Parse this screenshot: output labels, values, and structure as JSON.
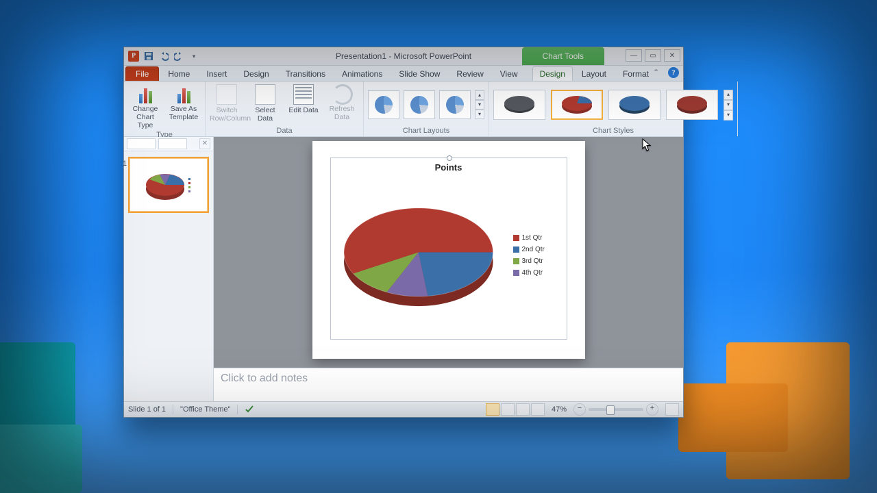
{
  "window": {
    "title": "Presentation1 - Microsoft PowerPoint",
    "context_tab": "Chart Tools"
  },
  "qat": {
    "save": "save-icon",
    "undo": "undo-icon",
    "redo": "redo-icon"
  },
  "tabs": {
    "file": "File",
    "home": "Home",
    "insert": "Insert",
    "design_main": "Design",
    "transitions": "Transitions",
    "animations": "Animations",
    "slideshow": "Slide Show",
    "review": "Review",
    "view": "View",
    "ct_design": "Design",
    "ct_layout": "Layout",
    "ct_format": "Format"
  },
  "ribbon": {
    "type": {
      "label": "Type",
      "change_chart_type": "Change Chart Type",
      "save_as_template": "Save As Template"
    },
    "data": {
      "label": "Data",
      "switch_row_col": "Switch Row/Column",
      "select_data": "Select Data",
      "edit_data": "Edit Data",
      "refresh_data": "Refresh Data"
    },
    "chart_layouts": {
      "label": "Chart Layouts"
    },
    "chart_styles": {
      "label": "Chart Styles"
    }
  },
  "slides_pane": {
    "slide_number": "1"
  },
  "notes": {
    "placeholder": "Click to add notes"
  },
  "status": {
    "slide": "Slide 1 of 1",
    "theme": "\"Office Theme\"",
    "zoom": "47%"
  },
  "chart_data": {
    "type": "pie",
    "title": "Points",
    "series": [
      {
        "name": "1st Qtr",
        "value": 58,
        "color": "#b03a30"
      },
      {
        "name": "2nd Qtr",
        "value": 23,
        "color": "#3b6fa8"
      },
      {
        "name": "3rd Qtr",
        "value": 10,
        "color": "#7fa746"
      },
      {
        "name": "4th Qtr",
        "value": 9,
        "color": "#7a6aa8"
      }
    ]
  }
}
